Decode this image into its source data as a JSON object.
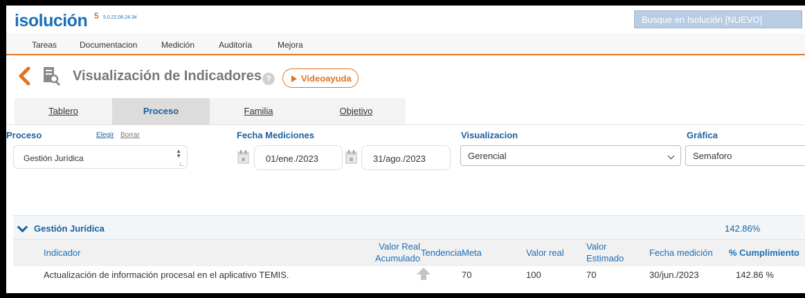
{
  "header": {
    "logo": "isolución",
    "logo_sup": "5",
    "version": "5.0.22.08.24.34",
    "search_placeholder": "Busque en Isolución [NUEVO]"
  },
  "menu": [
    "Tareas",
    "Documentacion",
    "Medición",
    "Auditoría",
    "Mejora"
  ],
  "page": {
    "title": "Visualización de Indicadores",
    "help": "?",
    "video_label": "Videoayuda"
  },
  "tabs": [
    {
      "label": "Tablero",
      "active": false
    },
    {
      "label": "Proceso",
      "active": true
    },
    {
      "label": "Familia",
      "active": false
    },
    {
      "label": "Objetivo",
      "active": false
    }
  ],
  "filters": {
    "proceso_label": "Proceso",
    "elegir": "Elegir",
    "borrar": "Borrar",
    "proceso_value": "Gestión Jurídica",
    "fecha_label": "Fecha Mediciones",
    "fecha_inicio": "01/ene./2023",
    "fecha_fin": "31/ago./2023",
    "visualizacion_label": "Visualizacion",
    "visualizacion_value": "Gerencial",
    "grafica_label": "Gráfica",
    "grafica_value": "Semaforo"
  },
  "group": {
    "title": "Gestión Jurídica",
    "percent": "142.86%"
  },
  "columns": {
    "indicador": "Indicador",
    "valor_real_acumulado_1": "Valor Real",
    "valor_real_acumulado_2": "Acumulado",
    "tendencia": "Tendencia",
    "meta": "Meta",
    "valor_real": "Valor real",
    "valor_estimado_1": "Valor",
    "valor_estimado_2": "Estimado",
    "fecha_medicion": "Fecha medición",
    "cumplimiento": "% Cumplimiento"
  },
  "rows": [
    {
      "indicador": "Actualización de información procesal en el aplicativo TEMIS.",
      "tendencia_icon": "arrow-up-icon",
      "meta": "70",
      "valor_real": "100",
      "valor_estimado": "70",
      "fecha_medicion": "30/jun./2023",
      "cumplimiento": "142.86 %"
    }
  ],
  "colors": {
    "brand_blue": "#1b6fb8",
    "accent_orange": "#e3721d",
    "label_blue": "#1b5f9e"
  }
}
